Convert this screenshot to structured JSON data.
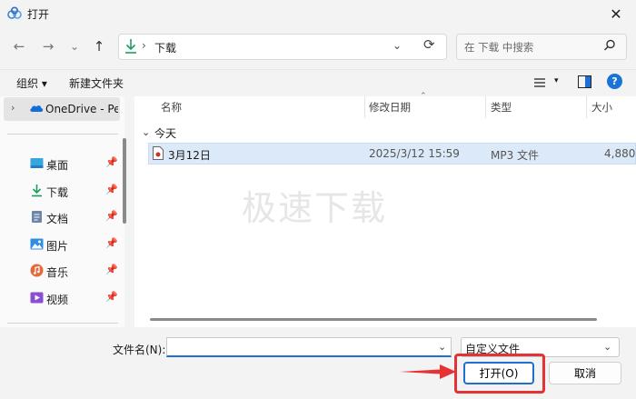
{
  "window": {
    "title": "打开",
    "close_glyph": "✕"
  },
  "nav": {
    "back": "←",
    "forward": "→",
    "recent": "⌄",
    "up": "↑"
  },
  "address": {
    "separator": "›",
    "location": "下载",
    "dropdown": "⌄",
    "refresh": "⟳"
  },
  "search": {
    "placeholder": "在 下载 中搜索"
  },
  "toolbar": {
    "organize": "组织 ▾",
    "new_folder": "新建文件夹",
    "view_dropdown": "▾",
    "help": "?"
  },
  "sidebar": {
    "onedrive": {
      "chevron": "›",
      "label": "OneDrive - Per"
    },
    "items": [
      {
        "label": "桌面",
        "icon": "desktop-icon",
        "pin": "📌"
      },
      {
        "label": "下载",
        "icon": "download-icon",
        "pin": "📌"
      },
      {
        "label": "文档",
        "icon": "document-icon",
        "pin": "📌"
      },
      {
        "label": "图片",
        "icon": "picture-icon",
        "pin": "📌"
      },
      {
        "label": "音乐",
        "icon": "music-icon",
        "pin": "📌"
      },
      {
        "label": "视频",
        "icon": "video-icon",
        "pin": "📌"
      }
    ]
  },
  "columns": {
    "name": "名称",
    "modified": "修改日期",
    "type": "类型",
    "size": "大小",
    "sort_caret": "⌃"
  },
  "group": {
    "chevron": "⌄",
    "label": "今天"
  },
  "files": [
    {
      "name": "3月12日",
      "modified": "2025/3/12 15:59",
      "type": "MP3 文件",
      "size": "4,880"
    }
  ],
  "watermark": "极速下载",
  "filename": {
    "label": "文件名(N):",
    "value": "",
    "dropdown": "⌄"
  },
  "filetype": {
    "selected": "自定义文件",
    "dropdown": "⌄"
  },
  "buttons": {
    "open": "打开(O)",
    "cancel": "取消"
  },
  "colors": {
    "accent": "#1f6fd1",
    "highlight_red": "#e63234",
    "selected_row": "#dbe9f8"
  }
}
